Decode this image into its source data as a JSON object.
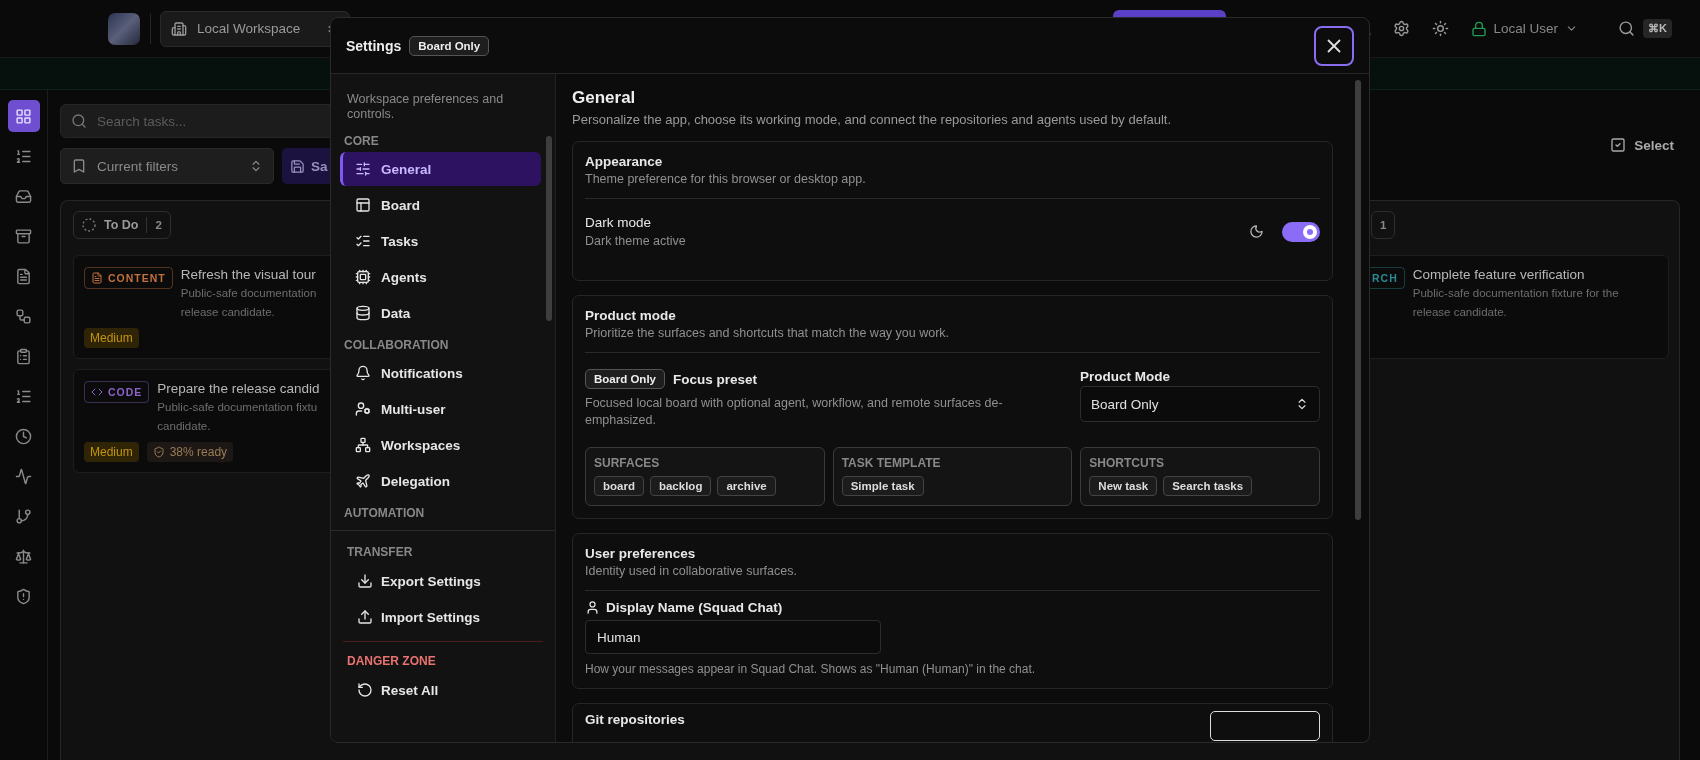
{
  "top_bar": {
    "workspace": "Local Workspace",
    "user": "Local User",
    "shortcut": "⌘K"
  },
  "rail": {
    "items": [
      {
        "selected": true
      },
      {
        "selected": false
      },
      {
        "selected": false
      },
      {
        "selected": false
      },
      {
        "selected": false
      },
      {
        "selected": false
      },
      {
        "selected": false
      },
      {
        "selected": false
      },
      {
        "selected": false
      },
      {
        "selected": false
      },
      {
        "selected": false
      },
      {
        "selected": false
      },
      {
        "selected": false
      }
    ]
  },
  "board": {
    "search": {
      "placeholder": "Search tasks..."
    },
    "filter": "Current filters",
    "save_button": "Sa",
    "select_button": "Select",
    "columns": [
      {
        "title": "To Do",
        "count": "2",
        "cards": [
          {
            "kind": "content",
            "tag": "CONTENT",
            "color": "#c2703d",
            "title": "Refresh the visual tour",
            "description": [
              "Public-safe documentation",
              "release candidate."
            ],
            "badges": [
              {
                "kind": "priority",
                "text": "Medium"
              }
            ]
          },
          {
            "kind": "code",
            "tag": "CODE",
            "color": "#8b63c9",
            "title": "Prepare the release candid",
            "description": [
              "Public-safe documentation fixtu",
              "candidate."
            ],
            "badges": [
              {
                "kind": "priority",
                "text": "Medium"
              },
              {
                "kind": "readiness",
                "text": "38% ready"
              }
            ]
          }
        ]
      },
      {
        "count": "1",
        "cards": [
          {
            "kind": "research",
            "tag": "RCH",
            "color": "#2a8a94",
            "title": "Complete feature verification",
            "description": [
              "Public-safe documentation fixture for the",
              "release candidate."
            ]
          }
        ]
      }
    ]
  },
  "settings": {
    "title": "Settings",
    "mode_badge": "Board Only",
    "intro": "Workspace preferences and controls.",
    "nav_groups": [
      {
        "label": "CORE",
        "items": [
          {
            "label": "General",
            "selected": true
          },
          {
            "label": "Board",
            "selected": false
          },
          {
            "label": "Tasks",
            "selected": false
          },
          {
            "label": "Agents",
            "selected": false
          },
          {
            "label": "Data",
            "selected": false
          }
        ]
      },
      {
        "label": "COLLABORATION",
        "items": [
          {
            "label": "Notifications",
            "selected": false
          },
          {
            "label": "Multi-user",
            "selected": false
          },
          {
            "label": "Workspaces",
            "selected": false
          },
          {
            "label": "Delegation",
            "selected": false
          }
        ]
      },
      {
        "label": "AUTOMATION"
      }
    ],
    "footer_groups": [
      {
        "kind": "normal",
        "label": "TRANSFER",
        "items": [
          "Export Settings",
          "Import Settings"
        ]
      },
      {
        "kind": "danger",
        "label": "DANGER ZONE",
        "items": [
          "Reset All"
        ]
      }
    ],
    "page": {
      "title": "General",
      "description": "Personalize the app, choose its working mode, and connect the repositories and agents used by default."
    },
    "appearance": {
      "title": "Appearance",
      "description": "Theme preference for this browser or desktop app.",
      "dark_mode": {
        "label": "Dark mode",
        "hint": "Dark theme active",
        "on": true
      }
    },
    "product_mode": {
      "title": "Product mode",
      "description": "Prioritize the surfaces and shortcuts that match the way you work.",
      "preset_badge": "Board Only",
      "preset_title": "Focus preset",
      "preset_description": "Focused local board with optional agent, workflow, and remote surfaces de-emphasized.",
      "select_label": "Product Mode",
      "select_value": "Board Only",
      "groups": [
        {
          "label": "SURFACES",
          "chips": [
            "board",
            "backlog",
            "archive"
          ]
        },
        {
          "label": "TASK TEMPLATE",
          "chips": [
            "Simple task"
          ]
        },
        {
          "label": "SHORTCUTS",
          "chips": [
            "New task",
            "Search tasks"
          ]
        }
      ]
    },
    "user_preferences": {
      "title": "User preferences",
      "description": "Identity used in collaborative surfaces.",
      "field_label": "Display Name (Squad Chat)",
      "field_value": "Human",
      "hint": "How your messages appear in Squad Chat. Shows as \"Human (Human)\" in the chat."
    },
    "git": {
      "title": "Git repositories"
    }
  }
}
